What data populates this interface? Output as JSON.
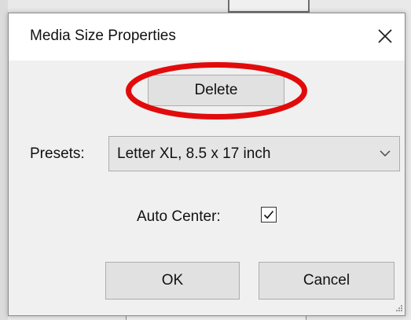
{
  "dialog": {
    "title": "Media Size Properties",
    "close_icon": "close-icon"
  },
  "actions": {
    "delete_label": "Delete",
    "ok_label": "OK",
    "cancel_label": "Cancel"
  },
  "presets": {
    "label": "Presets:",
    "selected_value": "Letter XL, 8.5 x 17 inch",
    "dropdown_icon": "chevron-down-icon"
  },
  "auto_center": {
    "label": "Auto Center:",
    "checked": true,
    "icon": "check-icon"
  },
  "colors": {
    "annotation_red": "#e20b0b",
    "dialog_background": "#f0f0f0",
    "titlebar_background": "#ffffff",
    "button_background": "#e1e1e1",
    "button_border": "#adadad"
  }
}
